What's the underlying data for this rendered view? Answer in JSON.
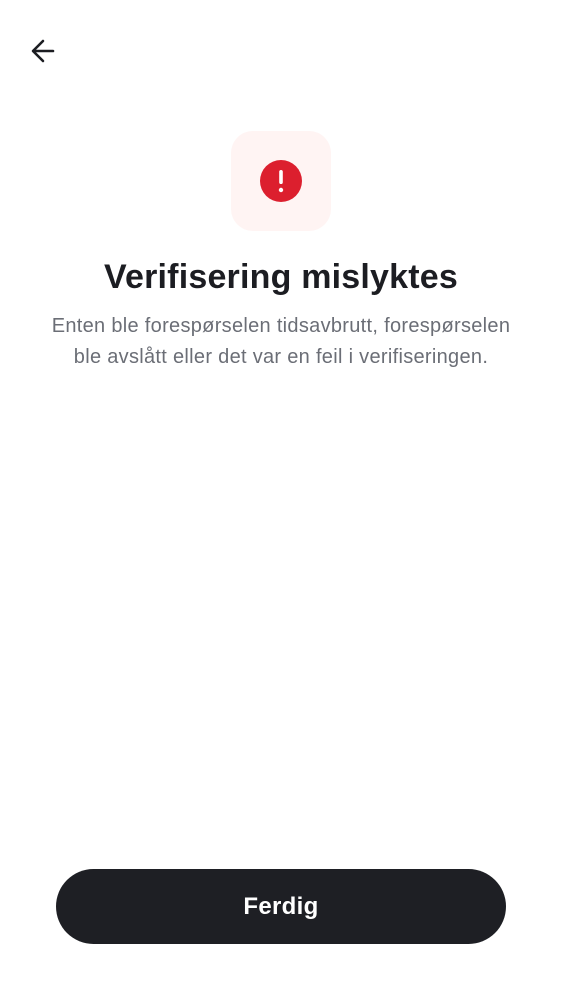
{
  "header": {
    "back_icon": "arrow-left-icon"
  },
  "status": {
    "icon": "error-exclamation-icon",
    "icon_color": "#dc1f2e",
    "tile_color": "#fff4f3"
  },
  "content": {
    "title": "Verifisering mislyktes",
    "description": "Enten ble forespørselen tidsavbrutt, forespørselen ble avslått eller det var en feil i verifiseringen."
  },
  "footer": {
    "done_label": "Ferdig",
    "button_color": "#1e1f24"
  }
}
